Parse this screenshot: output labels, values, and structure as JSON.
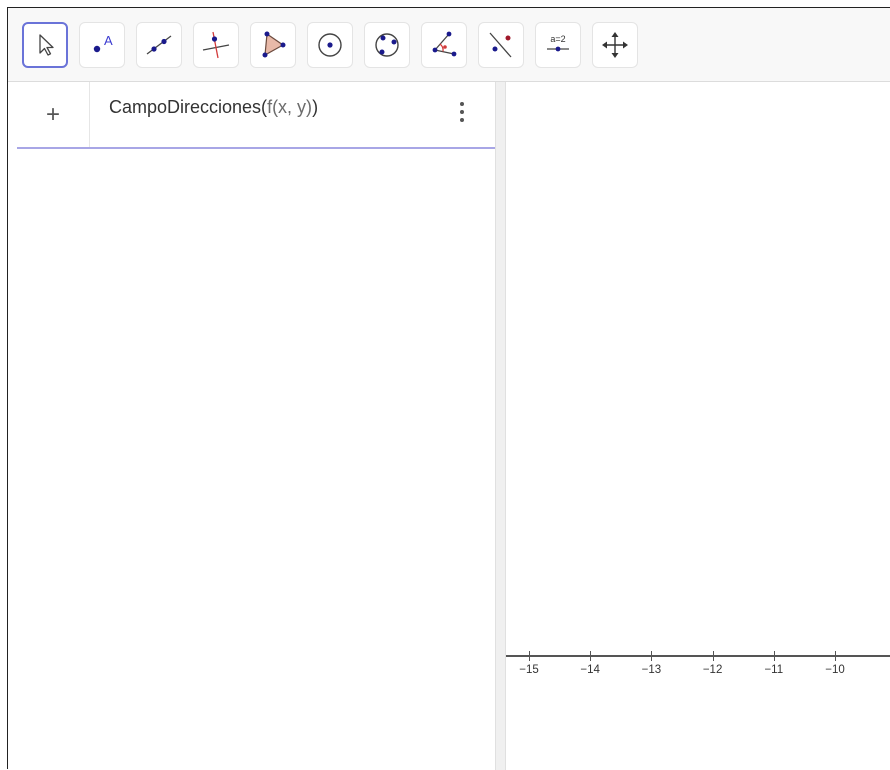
{
  "toolbar": {
    "tools": [
      {
        "name": "move-tool-button",
        "icon": "cursor-arrow-icon",
        "active": true
      },
      {
        "name": "point-tool-button",
        "icon": "point-label-icon",
        "label": "A"
      },
      {
        "name": "line-tool-button",
        "icon": "line-through-points-icon"
      },
      {
        "name": "perpendicular-line-tool-button",
        "icon": "perpendicular-line-icon"
      },
      {
        "name": "polygon-tool-button",
        "icon": "polygon-icon"
      },
      {
        "name": "circle-center-tool-button",
        "icon": "circle-center-point-icon"
      },
      {
        "name": "circle-three-points-tool-button",
        "icon": "circle-three-points-icon"
      },
      {
        "name": "angle-tool-button",
        "icon": "angle-icon"
      },
      {
        "name": "reflect-tool-button",
        "icon": "reflect-about-line-icon"
      },
      {
        "name": "slider-tool-button",
        "icon": "slider-icon",
        "label": "a=2"
      },
      {
        "name": "move-view-tool-button",
        "icon": "move-graphics-view-icon"
      }
    ]
  },
  "algebra": {
    "add_label": "+",
    "input_command": "CampoDirecciones(",
    "input_args": "f(x,  y)",
    "input_close": ")"
  },
  "graphics": {
    "x_ticks": [
      "−15",
      "−14",
      "−13",
      "−12",
      "−11",
      "−10"
    ]
  },
  "colors": {
    "accent": "#6a73d8",
    "input_underline": "#a8a6e6",
    "point_blue": "#1a1a8c",
    "line_red": "#d23b3b",
    "polygon_fill": "#e8b9a8"
  }
}
